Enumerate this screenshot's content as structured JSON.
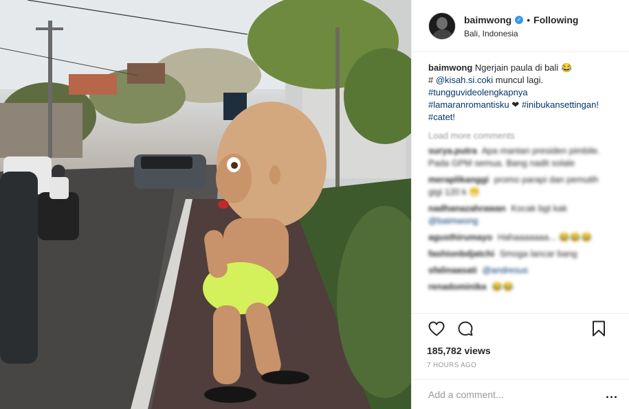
{
  "post": {
    "username": "baimwong",
    "verified_icon": "check-icon",
    "separator": "•",
    "follow_status": "Following",
    "location": "Bali, Indonesia"
  },
  "caption": {
    "username": "baimwong",
    "text_1": "Ngerjain paula di bali",
    "emoji": "😂",
    "hash": "#",
    "mention": "@kisah.si.coki",
    "text_2": "muncul lagi.",
    "tag_1": "#tungguvideolengkapnya",
    "tag_2": "#lamaranromantisku",
    "heart": "❤",
    "tag_3": "#inibukansettingan!",
    "tag_4": "#catet!"
  },
  "load_more": "Load more comments",
  "comments": [
    {
      "user": "surya.putra",
      "text": "Apa mantan presiden pimbile. Pada GPM semua. Bang nadit solale"
    },
    {
      "user": "meraplikanggi",
      "text": "promo parapi dan pemutih gigi 120 k 😁"
    },
    {
      "user": "nadhanazahrawan",
      "text": "Kocak bgt kak",
      "mention": "@baimwong"
    },
    {
      "user": "agusthirumayo",
      "text": "Hahaaaaaaa... 😂😂😂"
    },
    {
      "user": "fashionbdjatchi",
      "text": "Smoga lancar bang"
    },
    {
      "user": "sfalinaasati",
      "text": "",
      "mention": "@andresus"
    },
    {
      "user": "renadominika",
      "text": "😂😂"
    }
  ],
  "actions": {
    "like_icon": "heart-icon",
    "comment_icon": "comment-icon",
    "save_icon": "bookmark-icon"
  },
  "views": "185,782 views",
  "time": "7 HOURS AGO",
  "add_comment": {
    "placeholder": "Add a comment...",
    "more": "..."
  }
}
